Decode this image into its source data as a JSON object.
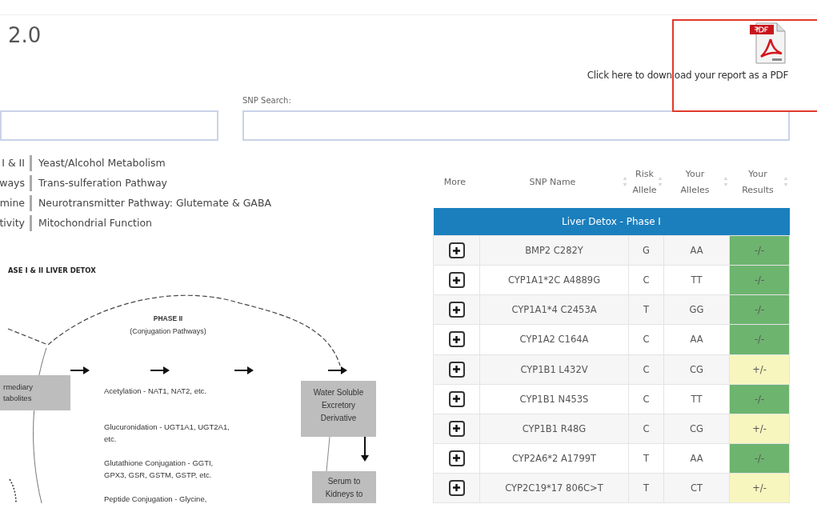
{
  "page_title": "2.0",
  "pdf_download": {
    "label": "Click here to download your report as a PDF",
    "highlighted": true
  },
  "search": {
    "label": "SNP Search:"
  },
  "pathways": [
    {
      "left": "I & II",
      "right": "Yeast/Alcohol Metabolism"
    },
    {
      "left": "ways",
      "right": "Trans-sulferation Pathway"
    },
    {
      "left": "mine",
      "right": "Neurotransmitter Pathway: Glutemate & GABA"
    },
    {
      "left": "tivity",
      "right": "Mitochondrial Function"
    }
  ],
  "diagram": {
    "heading": "ASE I & II LIVER DETOX",
    "phase_label": [
      "PHASE II",
      "(Conjugation Pathways)"
    ],
    "left_box": [
      "rmediary",
      "tabolites"
    ],
    "enzymes": [
      [
        "Acetylation  - NAT1, NAT2,      etc."
      ],
      [
        "Glucuronidation - UGT1A1, UGT2A1,",
        "etc."
      ],
      [
        "Glutathione Conjugation - GGTI,",
        "GPX3, GSR, GSTM, GSTP, etc."
      ],
      [
        "Peptide Conjugation - Glycine,"
      ]
    ],
    "output_box": [
      "Water Soluble",
      "Excretory",
      "Derivative"
    ],
    "serum_box": [
      "Serum to",
      "Kidneys to"
    ]
  },
  "table": {
    "columns": [
      "More",
      "SNP Name",
      "Risk Allele",
      "Your Alleles",
      "Your Results"
    ],
    "group": "Liver Detox - Phase I",
    "rows": [
      {
        "snp": "BMP2 C282Y",
        "risk": "G",
        "alleles": "AA",
        "result": "-/-",
        "color": "#6db46f"
      },
      {
        "snp": "CYP1A1*2C A4889G",
        "risk": "C",
        "alleles": "TT",
        "result": "-/-",
        "color": "#6db46f"
      },
      {
        "snp": "CYP1A1*4 C2453A",
        "risk": "T",
        "alleles": "GG",
        "result": "-/-",
        "color": "#6db46f"
      },
      {
        "snp": "CYP1A2 C164A",
        "risk": "C",
        "alleles": "AA",
        "result": "-/-",
        "color": "#6db46f"
      },
      {
        "snp": "CYP1B1 L432V",
        "risk": "C",
        "alleles": "CG",
        "result": "+/-",
        "color": "#f8f6bf"
      },
      {
        "snp": "CYP1B1 N453S",
        "risk": "C",
        "alleles": "TT",
        "result": "-/-",
        "color": "#6db46f"
      },
      {
        "snp": "CYP1B1 R48G",
        "risk": "C",
        "alleles": "CG",
        "result": "+/-",
        "color": "#f8f6bf"
      },
      {
        "snp": "CYP2A6*2 A1799T",
        "risk": "T",
        "alleles": "AA",
        "result": "-/-",
        "color": "#6db46f"
      },
      {
        "snp": "CYP2C19*17 806C>T",
        "risk": "T",
        "alleles": "CT",
        "result": "+/-",
        "color": "#f8f6bf"
      }
    ]
  }
}
